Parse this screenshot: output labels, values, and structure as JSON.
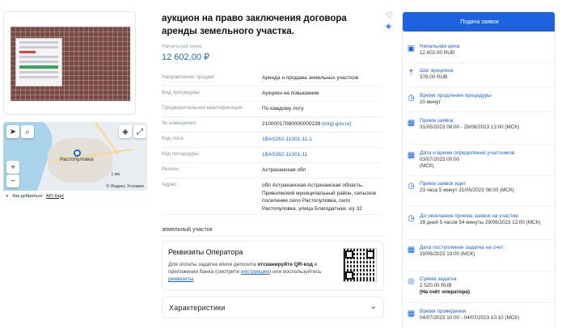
{
  "lot": {
    "title": "аукцион на право заключения договора аренды земельного участка.",
    "price_label": "Начальная цена",
    "price": "12 602,00 ₽"
  },
  "props": [
    {
      "k": "Направление продаж",
      "v": "Аренда и продажа земельных участков"
    },
    {
      "k": "Вид процедуры",
      "v": "Аукцион на повышение"
    },
    {
      "k": "Предварительная квалификация",
      "v": "По каждому лоту"
    },
    {
      "k": "№ извещения",
      "v": "21000017080000000239",
      "link": "(torgi.gov.ru)"
    },
    {
      "k": "Код лота",
      "v": "1BAS262-11001-11-1"
    },
    {
      "k": "Код процедуры",
      "v": "1BAS262-11001-11"
    },
    {
      "k": "Регион",
      "v": "Астраханская обл"
    },
    {
      "k": "Адрес",
      "v": "обл Астраханская Астраханская область, Приволжский муниципальный район, сельское поселение село Растопуловка, село Растопуловка, улица Благодатная, з/у 32"
    }
  ],
  "map": {
    "place": "Растопуловка",
    "scale": "1 км",
    "route": "Как добраться",
    "api": "API Карт",
    "provider": "© Яндекс",
    "terms": "Условия"
  },
  "description": "земельный участок",
  "operator": {
    "title": "Реквизиты Оператора",
    "text_1": "Для оплаты задатка и/или депозита ",
    "text_bold": "отсканируйте QR-код",
    "text_2": " в приложении банка (смотрите ",
    "link_1": "инструкцию",
    "text_3": ") или воспользуйтесь ",
    "link_2": "реквизиты"
  },
  "characteristics": "Характеристики",
  "sidebar": {
    "apply": "Подача заявок",
    "items": [
      {
        "icon": "money-icon",
        "label": "Начальная цена",
        "value": "12 602.00 RUB"
      },
      {
        "icon": "step-icon",
        "label": "Шаг аукциона",
        "value": "378.00 RUB"
      },
      {
        "icon": "clock-icon",
        "label": "Время продления процедуры",
        "value": "10 минут"
      },
      {
        "icon": "calendar-icon",
        "label": "Прием заявок",
        "value": "31/05/2023 08:00 - 29/06/2023 13:00 (МСК)"
      },
      {
        "icon": "calendar-icon",
        "label": "Дата и время определения участников",
        "value": "03/07/2023 00:00 (МСК)"
      },
      {
        "icon": "clock-icon",
        "label": "Прием заявок идет",
        "value": "23 часа 5 минут 31/05/2023 08:00 (МСК)"
      },
      {
        "icon": "clock-icon",
        "label": "До окончания приема заявок на участие",
        "value": "28 дней 5 часов 54 минуты 29/06/2023 13:00 (МСК)"
      },
      {
        "icon": "calendar-icon",
        "label": "Дата поступления задатка на счет :",
        "value": "29/06/2023 13:00 (МСК)"
      },
      {
        "icon": "coins-icon",
        "label": "Сумма задатка",
        "value": "2 520.00 RUB",
        "note": "(На счёт оператора)"
      },
      {
        "icon": "calendar-icon",
        "label": "Время проведения",
        "value": "04/07/2023 10:00 - 04/07/2023 10:10 (МСК)"
      }
    ]
  }
}
